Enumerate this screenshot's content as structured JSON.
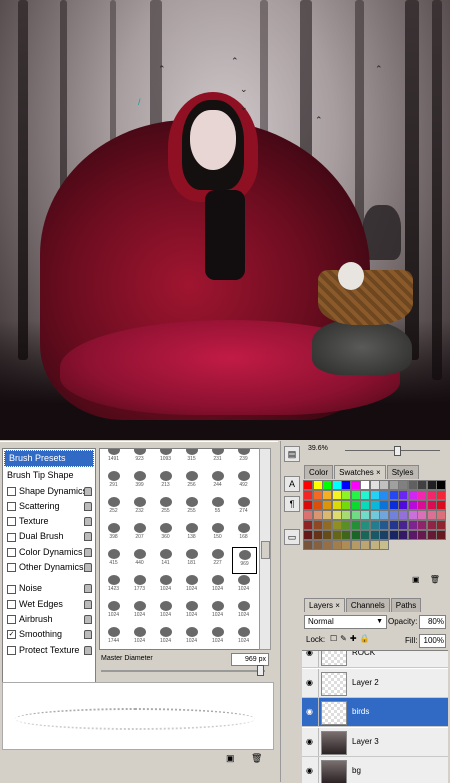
{
  "canvas": {
    "description_icon": "artwork-canvas"
  },
  "brush_panel": {
    "header": "Brush Presets",
    "items": [
      {
        "label": "Brush Tip Shape",
        "check": null
      },
      {
        "label": "Shape Dynamics",
        "check": false
      },
      {
        "label": "Scattering",
        "check": false
      },
      {
        "label": "Texture",
        "check": false
      },
      {
        "label": "Dual Brush",
        "check": false
      },
      {
        "label": "Color Dynamics",
        "check": false
      },
      {
        "label": "Other Dynamics",
        "check": false
      },
      {
        "label": "Noise",
        "check": false
      },
      {
        "label": "Wet Edges",
        "check": false
      },
      {
        "label": "Airbrush",
        "check": false
      },
      {
        "label": "Smoothing",
        "check": true
      },
      {
        "label": "Protect Texture",
        "check": false
      }
    ],
    "brush_sizes": [
      [
        "1491",
        "923",
        "1093",
        "315",
        "231",
        "239"
      ],
      [
        "291",
        "399",
        "213",
        "256",
        "244",
        "492"
      ],
      [
        "252",
        "232",
        "255",
        "255",
        "55",
        "274"
      ],
      [
        "398",
        "207",
        "360",
        "138",
        "150",
        "168"
      ],
      [
        "415",
        "440",
        "141",
        "181",
        "227",
        "969"
      ],
      [
        "1423",
        "1773",
        "1024",
        "1024",
        "1024",
        "1024"
      ],
      [
        "1024",
        "1024",
        "1024",
        "1024",
        "1024",
        "1024"
      ],
      [
        "1744",
        "1024",
        "1024",
        "1024",
        "1024",
        "1024"
      ]
    ],
    "selected_brush": "969",
    "master_diameter_label": "Master Diameter",
    "master_diameter_value": "969 px"
  },
  "zoom": {
    "value": "39.6%"
  },
  "color_panel": {
    "tabs": [
      "Color",
      "Swatches",
      "Styles"
    ],
    "active_tab": "Swatches"
  },
  "layers_panel": {
    "tabs": [
      "Layers",
      "Channels",
      "Paths"
    ],
    "active_tab": "Layers",
    "blend_mode": "Normal",
    "opacity_label": "Opacity:",
    "opacity_value": "80%",
    "lock_label": "Lock:",
    "fill_label": "Fill:",
    "fill_value": "100%",
    "layers": [
      {
        "name": "ROCK",
        "selected": false,
        "thumb": "transparent"
      },
      {
        "name": "Layer 2",
        "selected": false,
        "thumb": "transparent"
      },
      {
        "name": "birds",
        "selected": true,
        "thumb": "transparent"
      },
      {
        "name": "Layer 3",
        "selected": false,
        "thumb": "dark"
      },
      {
        "name": "bg",
        "selected": false,
        "thumb": "dark"
      }
    ]
  },
  "colors": {
    "selection": "#316ac5",
    "panel_bg": "#d4d0c8"
  }
}
